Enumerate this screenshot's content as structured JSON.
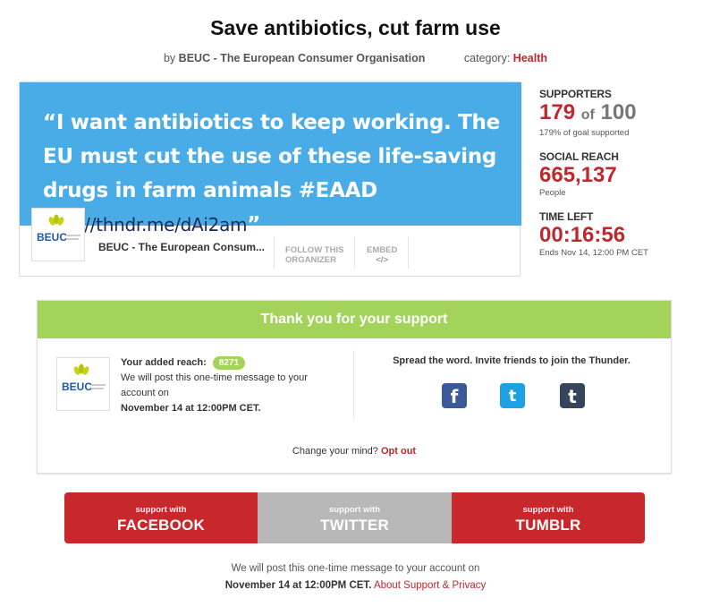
{
  "title": "Save antibiotics, cut farm use",
  "byline": {
    "by_label": "by",
    "organizer": "BEUC - The European Consumer Organisation",
    "category_label": "category:",
    "category": "Health"
  },
  "quote": {
    "text": "“I want antibiotics to keep working. The EU must cut the use of these life-saving drugs in farm animals #EAAD",
    "link": "http://thndr.me/dAi2am",
    "close": "”"
  },
  "organizer_card": {
    "logo_text": "BEUC",
    "logo_subtext": "The European Consumer Organisation",
    "name": "BEUC - The European Consum...",
    "follow_label_1": "FOLLOW THIS",
    "follow_label_2": "ORGANIZER",
    "embed_label": "EMBED",
    "embed_icon": "</>"
  },
  "stats": {
    "supporters_label": "SUPPORTERS",
    "supporters": "179",
    "of": "of",
    "goal": "100",
    "goal_text": "179% of goal supported",
    "reach_label": "SOCIAL REACH",
    "reach": "665,137",
    "reach_unit": "People",
    "time_label": "TIME LEFT",
    "time": "00:16:56",
    "ends": "Ends Nov 14, 12:00 PM CET"
  },
  "thanks": {
    "heading": "Thank you for your support",
    "reach_label": "Your added reach:",
    "reach_value": "8271",
    "msg_1": "We will post this one-time message to your",
    "msg_2": "account on",
    "msg_date": "November 14 at 12:00PM CET.",
    "spread": "Spread the word. Invite friends to join the Thunder.",
    "facebook_glyph": "f",
    "twitter_glyph": "t",
    "tumblr_glyph": "t",
    "change": "Change your mind?",
    "opt_out": "Opt out"
  },
  "buttons": {
    "facebook_small": "support with",
    "facebook_big": "FACEBOOK",
    "twitter_small": "support with",
    "twitter_big": "TWITTER",
    "tumblr_small": "support with",
    "tumblr_big": "TUMBLR"
  },
  "footer": {
    "line1": "We will post this one-time message to your account on",
    "date": "November 14 at 12:00PM CET.",
    "privacy": "About Support & Privacy"
  },
  "colors": {
    "brand_red": "#c8282c",
    "quote_blue": "#4aace7",
    "success_green": "#a3d35b",
    "facebook": "#3b5998",
    "twitter": "#1da1e2",
    "tumblr": "#35465c"
  }
}
